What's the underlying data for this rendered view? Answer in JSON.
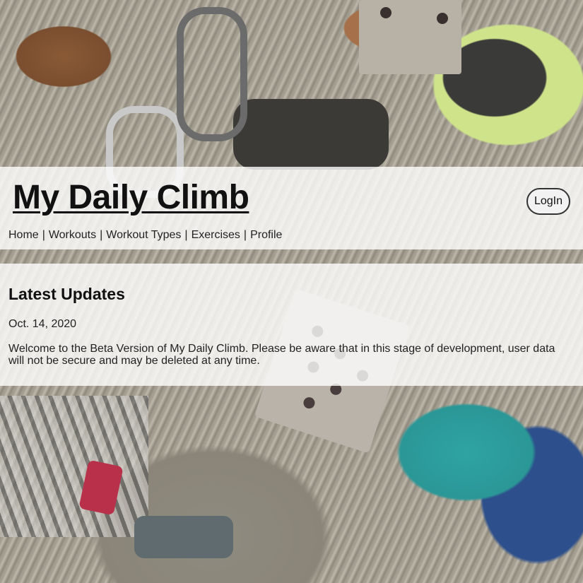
{
  "header": {
    "title": "My Daily Climb",
    "login_label": "LogIn",
    "nav": [
      {
        "label": "Home"
      },
      {
        "label": "Workouts"
      },
      {
        "label": "Workout Types"
      },
      {
        "label": "Exercises"
      },
      {
        "label": "Profile"
      }
    ],
    "separator": "|"
  },
  "updates": {
    "heading": "Latest Updates",
    "date": "Oct. 14, 2020",
    "message": "Welcome to the Beta Version of My Daily Climb. Please be aware that in this stage of development, user data will not be secure and may be deleted at any time."
  }
}
